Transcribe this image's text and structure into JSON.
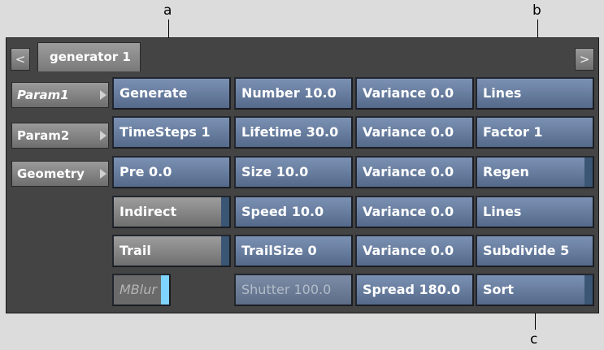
{
  "callouts": {
    "a": "a",
    "b": "b",
    "c": "c"
  },
  "nav": {
    "prev": "<",
    "next": ">"
  },
  "tab": {
    "label": "generator 1"
  },
  "params": [
    {
      "label": "Param1",
      "active": true
    },
    {
      "label": "Param2",
      "active": false
    },
    {
      "label": "Geometry",
      "active": false
    }
  ],
  "grid": {
    "row1": {
      "c1": "Generate",
      "c2": "Number 10.0",
      "c3": "Variance 0.0",
      "c4": "Lines"
    },
    "row2": {
      "c1": "TimeSteps 1",
      "c2": "Lifetime 30.0",
      "c3": "Variance 0.0",
      "c4": "Factor 1"
    },
    "row3": {
      "c1": "Pre 0.0",
      "c2": "Size 10.0",
      "c3": "Variance 0.0",
      "c4": "Regen"
    },
    "row4": {
      "c1": "Indirect",
      "c2": "Speed 10.0",
      "c3": "Variance 0.0",
      "c4": "Lines"
    },
    "row5": {
      "c1": "Trail",
      "c2": "TrailSize 0",
      "c3": "Variance 0.0",
      "c4": "Subdivide 5"
    },
    "row6": {
      "c1": "MBlur",
      "c2": "Shutter 100.0",
      "c3": "Spread 180.0",
      "c4": "Sort"
    }
  },
  "colors": {
    "field": "#6b81a3",
    "panel": "#444444",
    "background": "#dcdcdc",
    "mblur_indicator": "#7fd3ff"
  }
}
